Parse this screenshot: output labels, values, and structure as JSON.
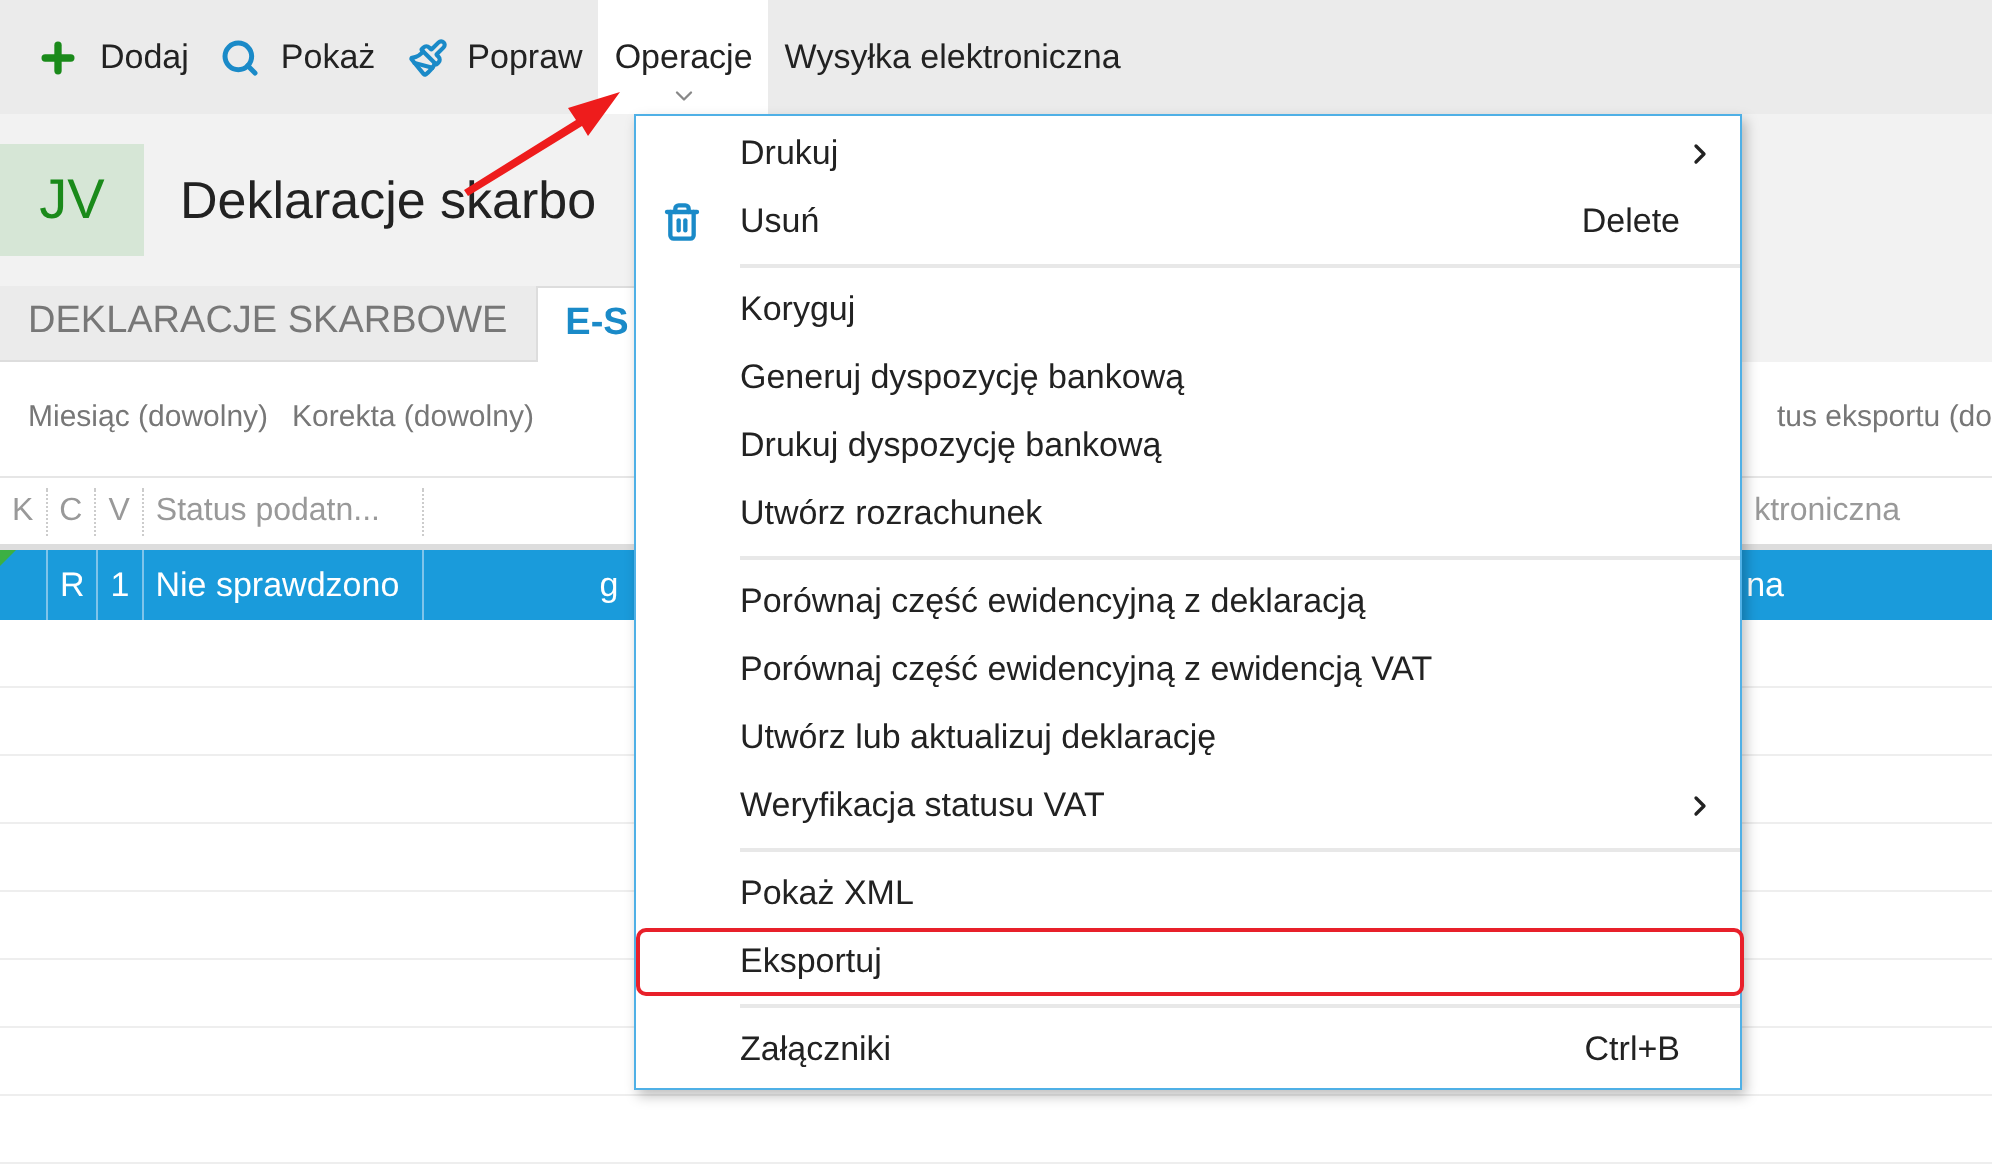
{
  "toolbar": {
    "items": [
      {
        "kind": "add",
        "label": "Dodaj",
        "selected": false
      },
      {
        "kind": "view",
        "label": "Pokaż",
        "selected": false
      },
      {
        "kind": "edit",
        "label": "Popraw",
        "selected": false
      },
      {
        "kind": "plain",
        "label": "Operacje",
        "selected": true
      },
      {
        "kind": "plain",
        "label": "Wysyłka elektroniczna",
        "selected": false
      }
    ]
  },
  "header": {
    "badge": "JV",
    "title": "Deklaracje skarbo"
  },
  "tabs": [
    {
      "label": "DEKLARACJE SKARBOWE",
      "selected": false
    },
    {
      "label": "E-S",
      "selected": true
    }
  ],
  "filters": {
    "left": [
      "Miesiąc (dowolny)",
      "Korekta (dowolny)"
    ],
    "right": "tus eksportu (do"
  },
  "table": {
    "columns": [
      "K",
      "C",
      "V",
      "Status podatn..."
    ],
    "right_column": "ktroniczna",
    "rows": [
      {
        "cells": [
          "",
          "R",
          "1",
          "Nie sprawdzono"
        ],
        "cut_cell": "g",
        "right_cell": "na",
        "selected": true
      }
    ]
  },
  "menu": {
    "sections": [
      {
        "items": [
          {
            "label": "Drukuj",
            "submenu": true,
            "highlighted": false
          },
          {
            "label": "Usuń",
            "kind": "delete",
            "shortcut": "Delete",
            "submenu": false,
            "highlighted": false
          }
        ]
      },
      {
        "items": [
          {
            "label": "Koryguj",
            "submenu": false,
            "highlighted": false
          },
          {
            "label": "Generuj dyspozycję bankową",
            "submenu": false,
            "highlighted": false
          },
          {
            "label": "Drukuj dyspozycję bankową",
            "submenu": false,
            "highlighted": false
          },
          {
            "label": "Utwórz rozrachunek",
            "submenu": false,
            "highlighted": false
          }
        ]
      },
      {
        "items": [
          {
            "label": "Porównaj część ewidencyjną z deklaracją",
            "submenu": false,
            "highlighted": false
          },
          {
            "label": "Porównaj część ewidencyjną z ewidencją VAT",
            "submenu": false,
            "highlighted": false
          },
          {
            "label": "Utwórz lub aktualizuj deklarację",
            "submenu": false,
            "highlighted": false
          },
          {
            "label": "Weryfikacja statusu VAT",
            "submenu": true,
            "highlighted": false
          }
        ]
      },
      {
        "items": [
          {
            "label": "Pokaż XML",
            "submenu": false,
            "highlighted": false
          },
          {
            "label": "Eksportuj",
            "submenu": false,
            "highlighted": true
          }
        ]
      },
      {
        "items": [
          {
            "label": "Załączniki",
            "shortcut": "Ctrl+B",
            "submenu": false,
            "highlighted": false
          }
        ]
      }
    ]
  },
  "annotation": {
    "arrow": true
  }
}
